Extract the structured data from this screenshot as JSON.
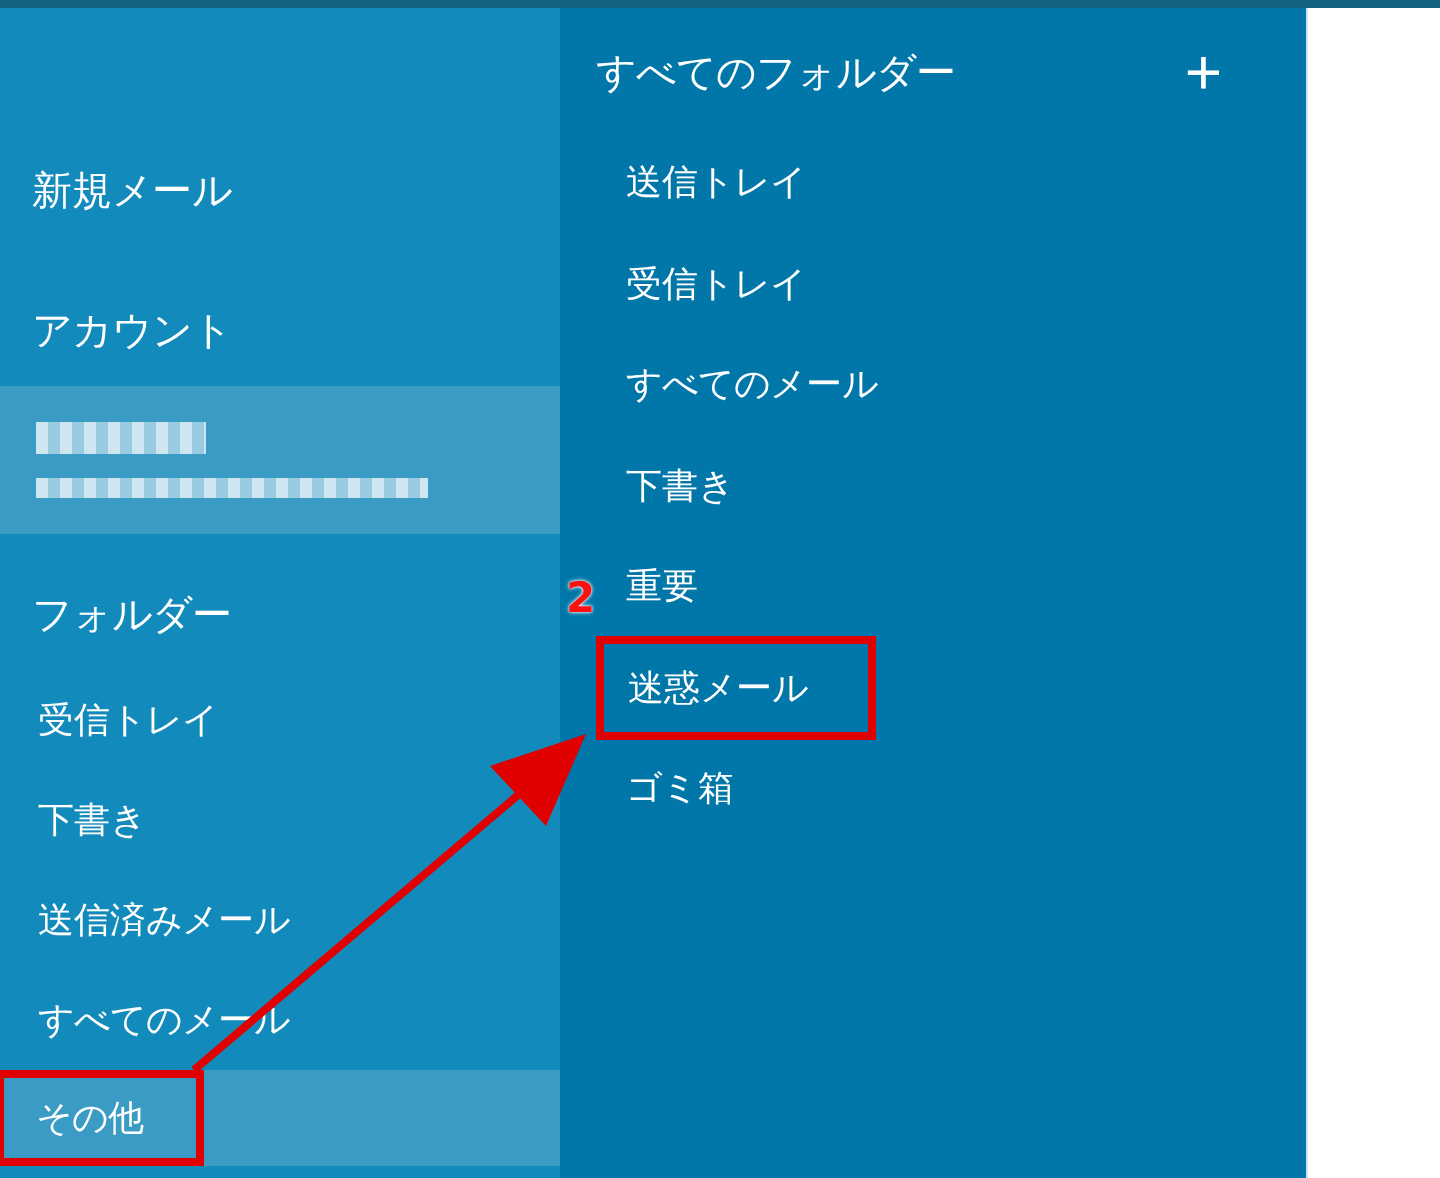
{
  "sidebar": {
    "new_mail": "新規メール",
    "accounts_heading": "アカウント",
    "folders_heading": "フォルダー",
    "folders": [
      {
        "label": "受信トレイ",
        "selected": false,
        "boxed": false
      },
      {
        "label": "下書き",
        "selected": false,
        "boxed": false
      },
      {
        "label": "送信済みメール",
        "selected": false,
        "boxed": false
      },
      {
        "label": "すべてのメール",
        "selected": false,
        "boxed": false
      },
      {
        "label": "その他",
        "selected": true,
        "boxed": true
      }
    ]
  },
  "all_folders": {
    "title": "すべてのフォルダー",
    "add_label": "+",
    "items": [
      {
        "label": "送信トレイ",
        "boxed": false
      },
      {
        "label": "受信トレイ",
        "boxed": false
      },
      {
        "label": "すべてのメール",
        "boxed": false
      },
      {
        "label": "下書き",
        "boxed": false
      },
      {
        "label": "重要",
        "boxed": false
      },
      {
        "label": "迷惑メール",
        "boxed": true
      },
      {
        "label": "ゴミ箱",
        "boxed": false
      }
    ]
  },
  "annotation": {
    "step": "2"
  }
}
